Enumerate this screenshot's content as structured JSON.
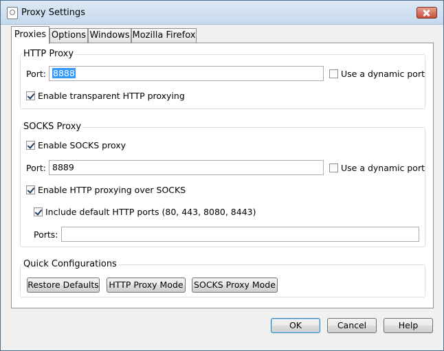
{
  "window": {
    "title": "Proxy Settings"
  },
  "tabs": [
    {
      "label": "Proxies"
    },
    {
      "label": "Options"
    },
    {
      "label": "Windows"
    },
    {
      "label": "Mozilla Firefox"
    }
  ],
  "http_proxy": {
    "group_label": "HTTP Proxy",
    "port_label": "Port:",
    "port_value": "8888",
    "dynamic_port_label": "Use a dynamic port",
    "dynamic_port_checked": false,
    "transparent_label": "Enable transparent HTTP proxying",
    "transparent_checked": true
  },
  "socks_proxy": {
    "group_label": "SOCKS Proxy",
    "enable_label": "Enable SOCKS proxy",
    "enable_checked": true,
    "port_label": "Port:",
    "port_value": "8889",
    "dynamic_port_label": "Use a dynamic port",
    "dynamic_port_checked": false,
    "http_over_socks_label": "Enable HTTP proxying over SOCKS",
    "http_over_socks_checked": true,
    "include_ports_label": "Include default HTTP ports (80, 443, 8080, 8443)",
    "include_ports_checked": true,
    "ports_label": "Ports:",
    "ports_value": ""
  },
  "quick_configurations": {
    "group_label": "Quick Configurations",
    "restore_defaults": "Restore Defaults",
    "http_proxy_mode": "HTTP Proxy Mode",
    "socks_proxy_mode": "SOCKS Proxy Mode"
  },
  "footer": {
    "ok": "OK",
    "cancel": "Cancel",
    "help": "Help"
  }
}
